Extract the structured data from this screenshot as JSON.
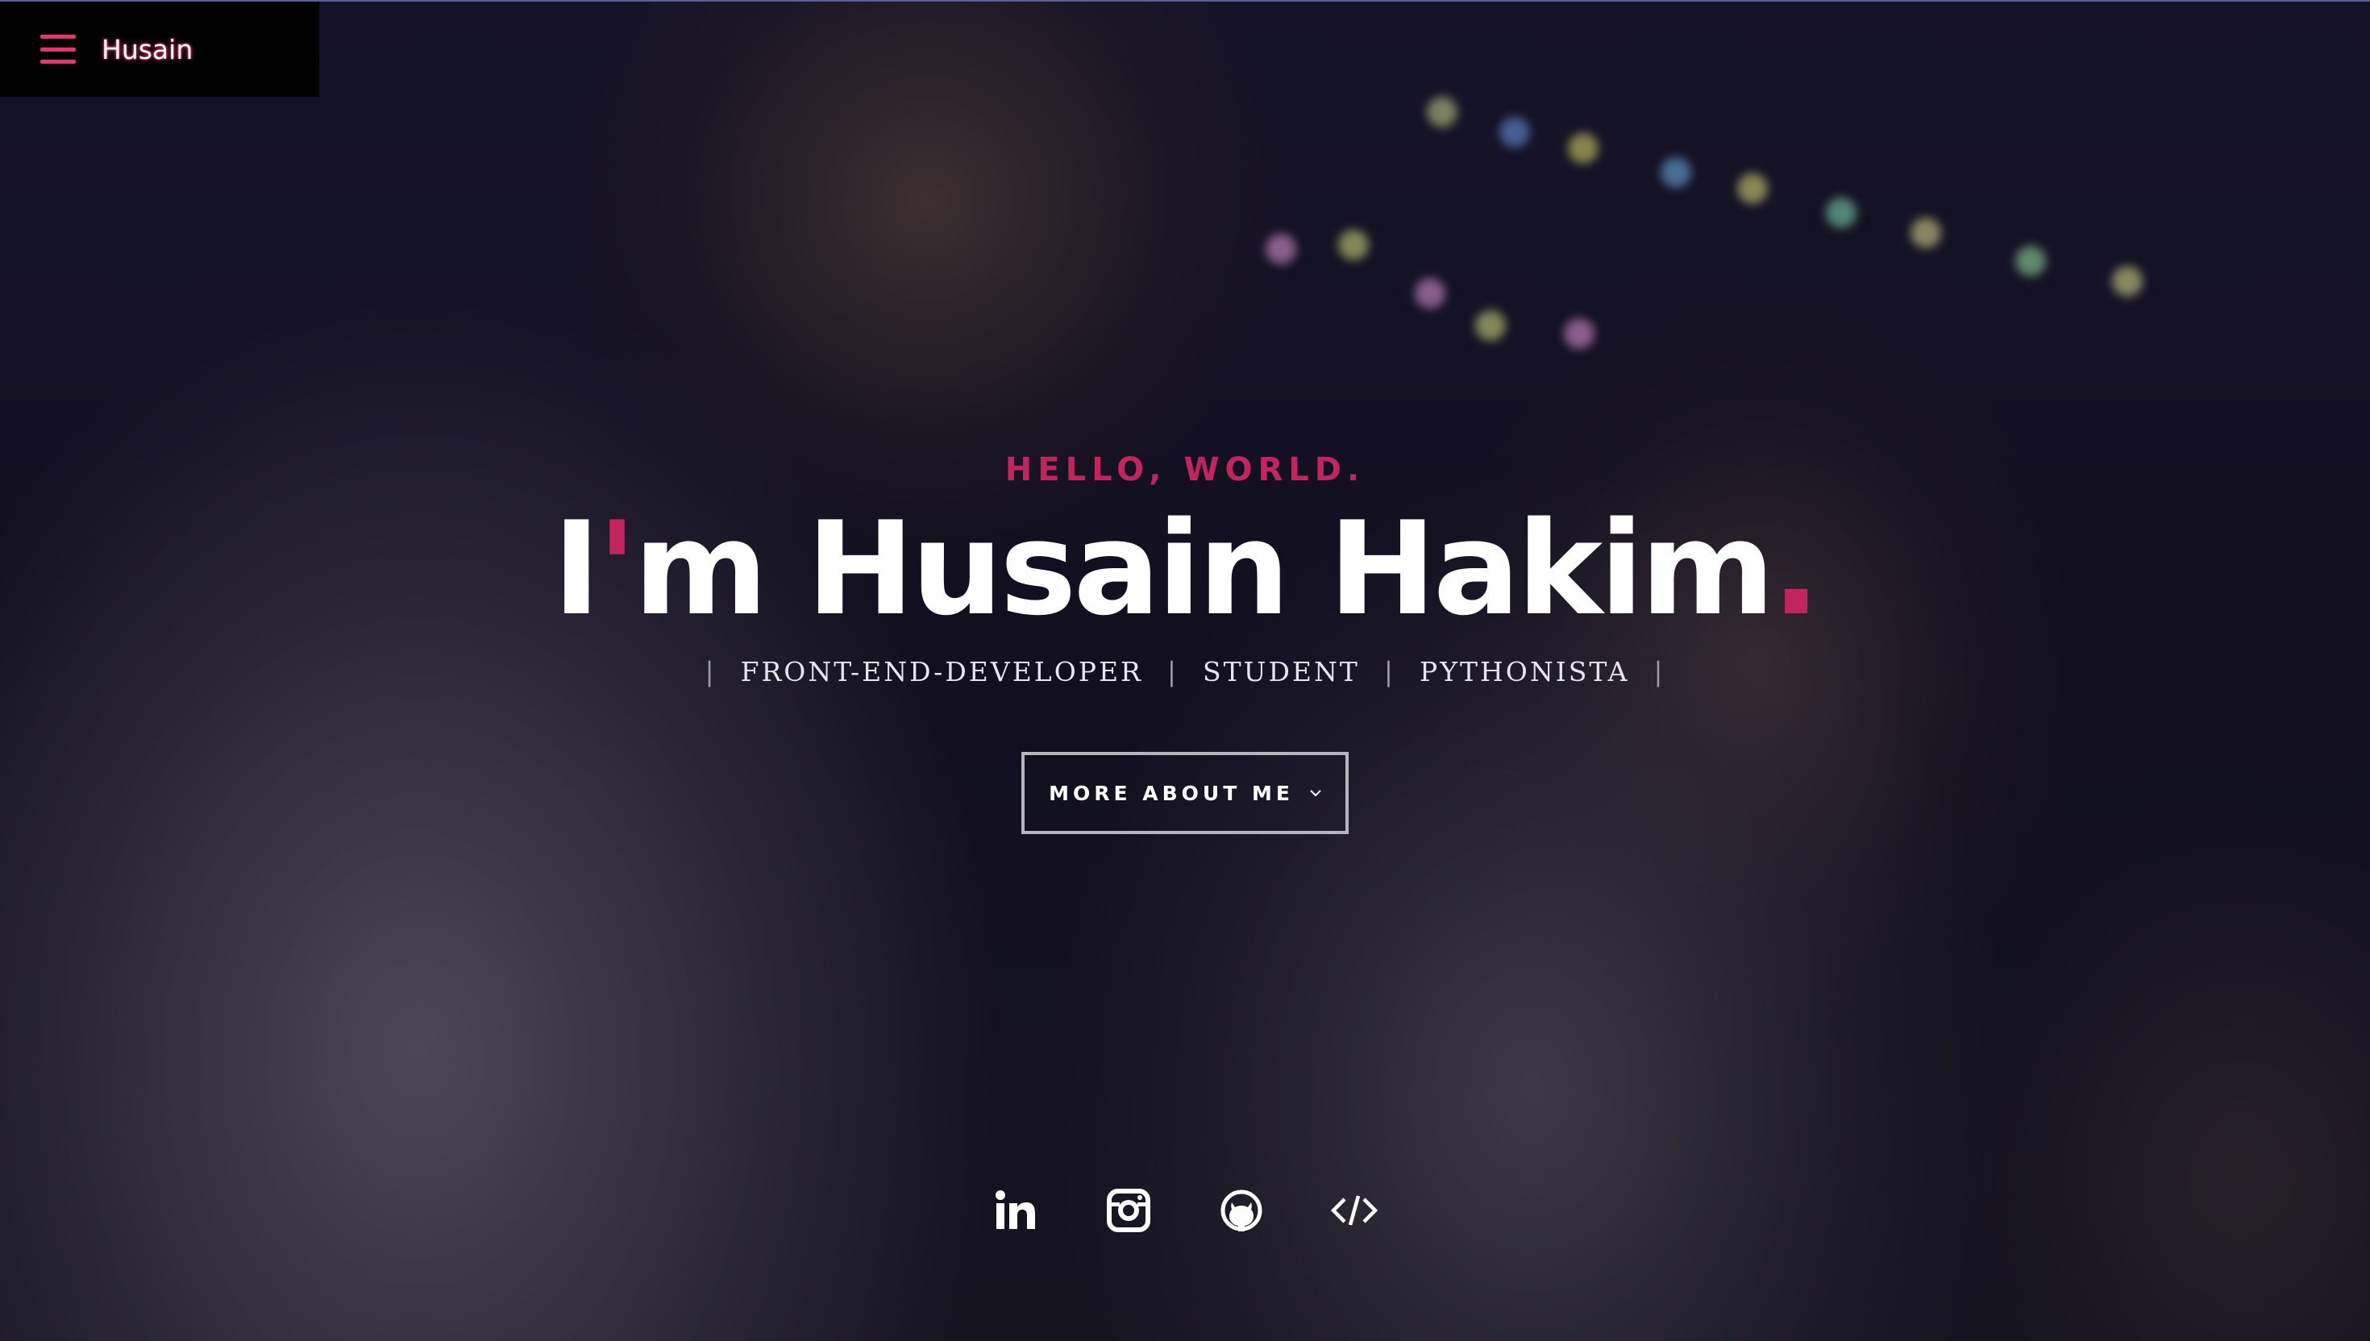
{
  "header": {
    "logo_text": "Husain",
    "menu_icon": "hamburger-menu-icon"
  },
  "intro": {
    "pretitle": "HELLO, WORLD.",
    "title_prefix_letter": "I",
    "title_apostrophe": "'",
    "title_rest": "m Husain Hakim",
    "title_period": ".",
    "roles": [
      "FRONT-END-DEVELOPER",
      "STUDENT",
      "PYTHONISTA"
    ],
    "role_separator": "|",
    "cta_label": "MORE ABOUT ME",
    "cta_icon": "chevron-down-icon"
  },
  "social": [
    {
      "name": "linkedin",
      "icon": "linkedin-icon"
    },
    {
      "name": "instagram",
      "icon": "instagram-icon"
    },
    {
      "name": "github",
      "icon": "github-icon"
    },
    {
      "name": "code",
      "icon": "code-icon"
    }
  ],
  "colors": {
    "accent": "#c1245f",
    "menu_accent": "#e8336e",
    "text": "#ffffff",
    "nav_bg": "#000000"
  }
}
